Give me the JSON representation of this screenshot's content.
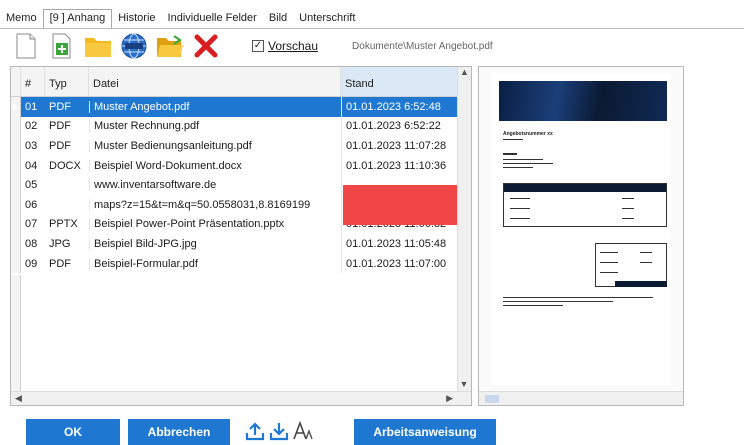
{
  "tabs": [
    {
      "label": "Memo"
    },
    {
      "label": "[9 ] Anhang"
    },
    {
      "label": "Historie"
    },
    {
      "label": "Individuelle Felder"
    },
    {
      "label": "Bild"
    },
    {
      "label": "Unterschrift"
    }
  ],
  "toolbar": {
    "preview_label": "Vorschau",
    "preview_checked": true,
    "preview_path": "Dokumente\\Muster Angebot.pdf",
    "icons": [
      "new-document-icon",
      "add-file-icon",
      "folder-icon",
      "web-link-icon",
      "open-folder-icon",
      "delete-icon"
    ]
  },
  "grid": {
    "columns": [
      "#",
      "Typ",
      "Datei",
      "Stand"
    ],
    "rows": [
      {
        "num": "01",
        "typ": "PDF",
        "datei": "Muster Angebot.pdf",
        "stand": "01.01.2023  6:52:48",
        "selected": true
      },
      {
        "num": "02",
        "typ": "PDF",
        "datei": "Muster Rechnung.pdf",
        "stand": "01.01.2023  6:52:22"
      },
      {
        "num": "03",
        "typ": "PDF",
        "datei": "Muster Bedienungsanleitung.pdf",
        "stand": "01.01.2023  11:07:28"
      },
      {
        "num": "04",
        "typ": "DOCX",
        "datei": "Beispiel Word-Dokument.docx",
        "stand": "01.01.2023  11:10:36"
      },
      {
        "num": "05",
        "typ": "",
        "datei": "www.inventarsoftware.de",
        "stand": ""
      },
      {
        "num": "06",
        "typ": "",
        "datei": "maps?z=15&t=m&q=50.0558031,8.8169199",
        "stand": ""
      },
      {
        "num": "07",
        "typ": "PPTX",
        "datei": "Beispiel Power-Point Präsentation.pptx",
        "stand": "01.01.2023  11:06:32"
      },
      {
        "num": "08",
        "typ": "JPG",
        "datei": "Beispiel Bild-JPG.jpg",
        "stand": "01.01.2023  11:05:48"
      },
      {
        "num": "09",
        "typ": "PDF",
        "datei": "Beispiel-Formular.pdf",
        "stand": "01.01.2023  11:07:00"
      }
    ]
  },
  "preview": {
    "doc_title": "Angebotsnummer xx"
  },
  "buttons": {
    "ok": "OK",
    "cancel": "Abbrechen",
    "work_instruction": "Arbeitsanweisung"
  },
  "colors": {
    "accent": "#1e78d2",
    "highlight_red": "#f04545"
  }
}
